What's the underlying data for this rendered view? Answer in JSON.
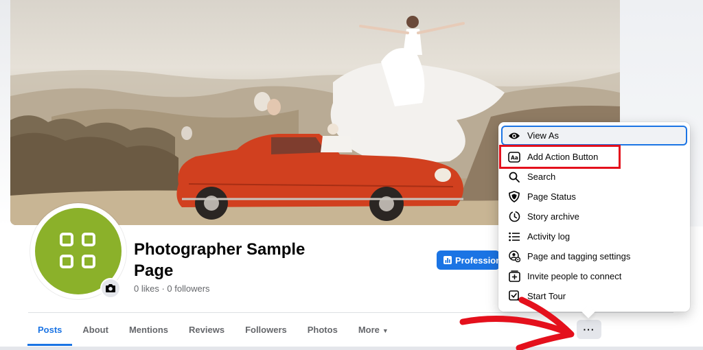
{
  "page": {
    "title": "Photographer Sample Page",
    "stats": "0 likes · 0 followers",
    "professional_button": "Professional dashboard"
  },
  "tabs": [
    {
      "label": "Posts",
      "active": true
    },
    {
      "label": "About"
    },
    {
      "label": "Mentions"
    },
    {
      "label": "Reviews"
    },
    {
      "label": "Followers"
    },
    {
      "label": "Photos"
    },
    {
      "label": "More"
    }
  ],
  "more_button_label": "···",
  "menu": {
    "items": [
      {
        "label": "View As",
        "icon": "eye-icon"
      },
      {
        "label": "Add Action Button",
        "icon": "action-button-icon"
      },
      {
        "label": "Search",
        "icon": "search-icon"
      },
      {
        "label": "Page Status",
        "icon": "shield-icon"
      },
      {
        "label": "Story archive",
        "icon": "clock-icon"
      },
      {
        "label": "Activity log",
        "icon": "list-icon"
      },
      {
        "label": "Page and tagging settings",
        "icon": "person-gear-icon"
      },
      {
        "label": "Invite people to connect",
        "icon": "invite-icon"
      },
      {
        "label": "Start Tour",
        "icon": "tour-icon"
      }
    ]
  },
  "colors": {
    "accent": "#1b74e4",
    "avatar": "#8bb12a",
    "annotation": "#e4101c",
    "car": "#d1401f"
  }
}
